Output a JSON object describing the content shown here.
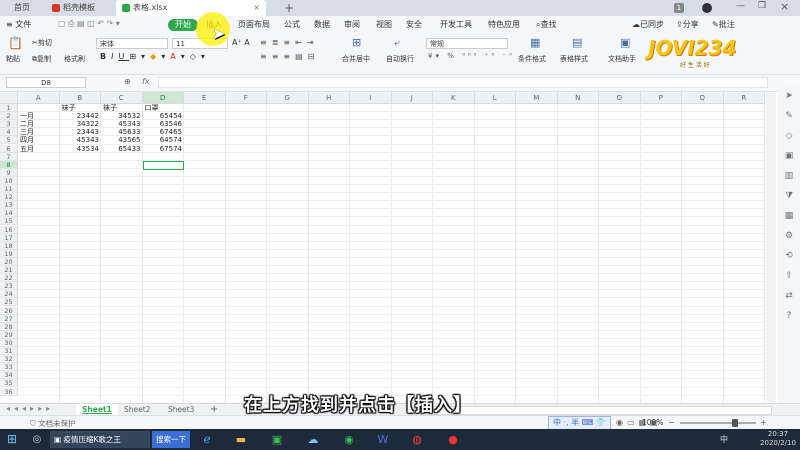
{
  "tabs": [
    {
      "label": "首页",
      "active": false
    },
    {
      "label": "稻壳模板",
      "active": false
    },
    {
      "label": "表格.xlsx",
      "active": true
    }
  ],
  "tab_badge": "1",
  "menu": {
    "file": "文件",
    "items": [
      "开始",
      "插入",
      "页面布局",
      "公式",
      "数据",
      "审阅",
      "视图",
      "安全",
      "开发工具",
      "特色应用"
    ],
    "active": "开始",
    "search": "查找",
    "sync": "已同步",
    "share": "分享",
    "comment": "批注"
  },
  "ribbon": {
    "cut": "剪切",
    "paste": "粘贴",
    "copy": "复制",
    "format_painter": "格式刷",
    "font_name": "宋体",
    "font_size": "11",
    "merge": "合并居中",
    "wrap": "自动换行",
    "number_format": "常规",
    "cond_format": "条件格式",
    "table_style": "表格样式",
    "doc_helper": "文档助手"
  },
  "formula_bar": {
    "cell_ref": "D8",
    "fx": "fx",
    "value": ""
  },
  "columns": [
    "A",
    "B",
    "C",
    "D",
    "E",
    "F",
    "G",
    "H",
    "I",
    "J",
    "K",
    "L",
    "M",
    "N",
    "O",
    "P",
    "Q",
    "R"
  ],
  "selected_column": "D",
  "selected_row": 8,
  "row_count": 36,
  "table": {
    "headers": [
      "",
      "袜子",
      "袜子",
      "口罩"
    ],
    "rows": [
      [
        "一月",
        "23442",
        "34532",
        "65454"
      ],
      [
        "二月",
        "34322",
        "45343",
        "63546"
      ],
      [
        "三月",
        "23443",
        "45633",
        "67465"
      ],
      [
        "四月",
        "45343",
        "43565",
        "64574"
      ],
      [
        "五月",
        "43534",
        "65433",
        "67574"
      ]
    ]
  },
  "sheets": [
    {
      "label": "Sheet1",
      "active": true
    },
    {
      "label": "Sheet2",
      "active": false
    },
    {
      "label": "Sheet3",
      "active": false
    }
  ],
  "status": {
    "protect": "文档未保护",
    "zoom": "100%"
  },
  "ime": "中",
  "ime_half": "半",
  "taskbar": {
    "search": "搜索一下",
    "app1": "疫情压缩K歌之王",
    "clock_time": "20:37",
    "clock_date": "2020/2/10",
    "tray_lang": "中"
  },
  "caption": "在上方找到并点击【插入】",
  "logo": "JOVI234",
  "logo_sub": "好 生 活 好"
}
